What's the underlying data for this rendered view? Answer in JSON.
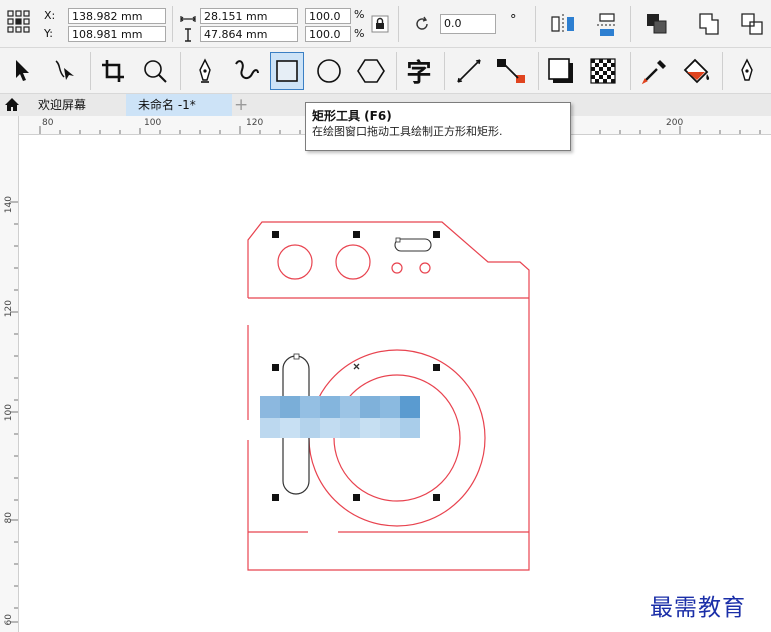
{
  "property_bar": {
    "x_label": "X:",
    "x_value": "138.982 mm",
    "y_label": "Y:",
    "y_value": "108.981 mm",
    "width_value": "28.151 mm",
    "height_value": "47.864 mm",
    "scale_x": "100.0",
    "scale_y": "100.0",
    "percent_symbol": "%",
    "rotation_value": "0.0",
    "degree_symbol": "°"
  },
  "tabs": [
    {
      "label": "欢迎屏幕",
      "active": false
    },
    {
      "label": "未命名 -1*",
      "active": true
    }
  ],
  "add_tab_label": "+",
  "ruler": {
    "h_labels": [
      "80",
      "100",
      "120",
      "200"
    ],
    "v_labels": [
      "140",
      "120",
      "100",
      "80",
      "60"
    ]
  },
  "tooltip": {
    "title": "矩形工具 (F6)",
    "description": "在绘图窗口拖动工具绘制正方形和矩形."
  },
  "watermark": "最需教育",
  "colors": {
    "outline": "#e8434f",
    "selection": "#000000",
    "accent": "#3a7fc4",
    "watermark": "#1b2fa8"
  }
}
